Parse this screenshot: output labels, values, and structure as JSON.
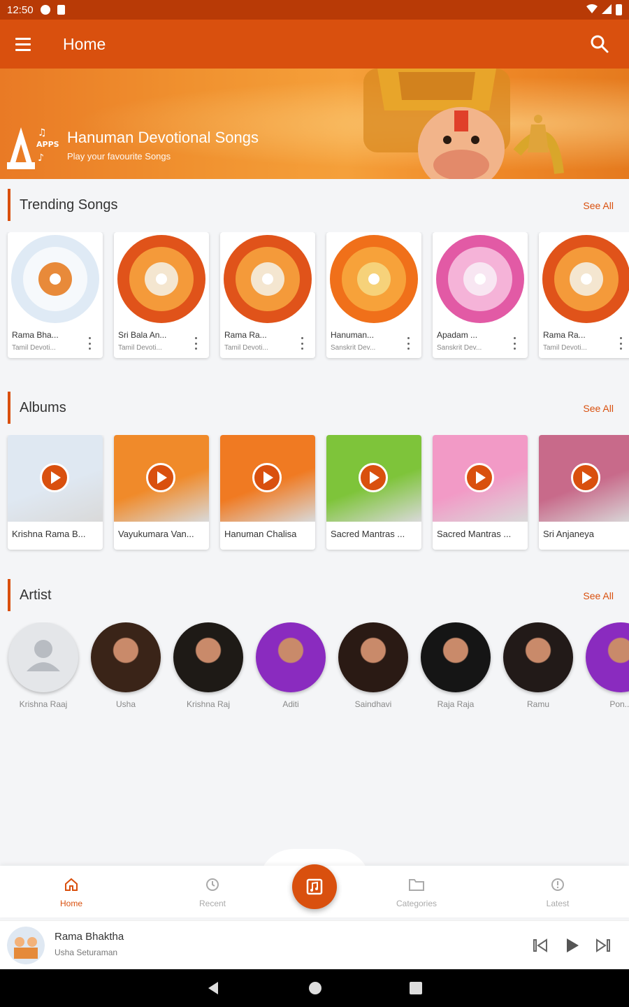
{
  "status_bar": {
    "time": "12:50"
  },
  "app_bar": {
    "title": "Home"
  },
  "banner": {
    "title": "Hanuman Devotional Songs",
    "subtitle": "Play your favourite Songs",
    "logo_text": "APPS"
  },
  "sections": {
    "trending": {
      "label": "Trending Songs",
      "see_all": "See All"
    },
    "albums": {
      "label": "Albums",
      "see_all": "See All"
    },
    "artist": {
      "label": "Artist",
      "see_all": "See All"
    }
  },
  "trending_songs": [
    {
      "title": "Rama Bha...",
      "subtitle": "Tamil Devoti...",
      "art": "white"
    },
    {
      "title": "Sri Bala An...",
      "subtitle": "Tamil Devoti...",
      "art": "disc-orange"
    },
    {
      "title": "Rama Ra...",
      "subtitle": "Tamil Devoti...",
      "art": "disc-orange"
    },
    {
      "title": "Hanuman...",
      "subtitle": "Sanskrit Dev...",
      "art": "disc-chalisa"
    },
    {
      "title": "Apadam ...",
      "subtitle": "Sanskrit Dev...",
      "art": "disc-pink"
    },
    {
      "title": "Rama Ra...",
      "subtitle": "Tamil Devoti...",
      "art": "disc-orange"
    }
  ],
  "albums": [
    {
      "title": "Krishna Rama B...",
      "art": "#dfe8f2"
    },
    {
      "title": "Vayukumara Van...",
      "art": "#f08a2a"
    },
    {
      "title": "Hanuman Chalisa",
      "art": "#f07a22"
    },
    {
      "title": "Sacred Mantras ...",
      "art": "#7ec43a"
    },
    {
      "title": "Sacred Mantras ...",
      "art": "#f29ac6"
    },
    {
      "title": "Sri Anjaneya",
      "art": "#c86a8a"
    }
  ],
  "artists": [
    {
      "name": "Krishna Raaj",
      "avatar": "placeholder"
    },
    {
      "name": "Usha",
      "avatar": "#3a2418"
    },
    {
      "name": "Krishna Raj",
      "avatar": "#1e1a16"
    },
    {
      "name": "Aditi",
      "avatar": "#8a2bbf"
    },
    {
      "name": "Saindhavi",
      "avatar": "#2a1a14"
    },
    {
      "name": "Raja Raja",
      "avatar": "#151515"
    },
    {
      "name": "Ramu",
      "avatar": "#221a18"
    },
    {
      "name": "Pon...",
      "avatar": "#8a2bbf"
    }
  ],
  "bottom_nav": {
    "home": "Home",
    "recent": "Recent",
    "categories": "Categories",
    "latest": "Latest"
  },
  "now_playing": {
    "song": "Rama Bhaktha",
    "artist": "Usha Seturaman"
  },
  "colors": {
    "accent": "#d9500e",
    "status_bar": "#b83a06"
  }
}
